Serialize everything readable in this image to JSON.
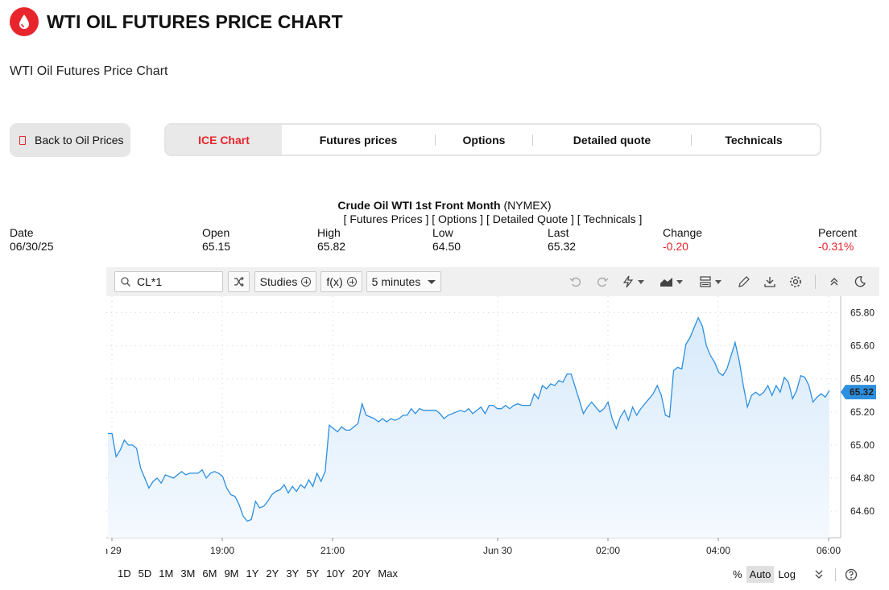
{
  "header": {
    "title": "WTI OIL FUTURES PRICE CHART",
    "logo_icon": "oil-drop-icon",
    "subtitle": "WTI Oil Futures Price Chart"
  },
  "nav": {
    "back_label": "Back to Oil Prices",
    "tabs": [
      {
        "label": "ICE Chart",
        "active": true
      },
      {
        "label": "Futures prices",
        "active": false
      },
      {
        "label": "Options",
        "active": false
      },
      {
        "label": "Detailed quote",
        "active": false
      },
      {
        "label": "Technicals",
        "active": false
      }
    ]
  },
  "instrument": {
    "name": "Crude Oil WTI 1st Front Month",
    "exchange": "(NYMEX)",
    "links": "[ Futures Prices ] [ Options ] [ Detailed Quote ] [ Technicals ]"
  },
  "quote": {
    "date_label": "Date",
    "date": "06/30/25",
    "open_label": "Open",
    "open": "65.15",
    "high_label": "High",
    "high": "65.82",
    "low_label": "Low",
    "low": "64.50",
    "last_label": "Last",
    "last": "65.32",
    "change_label": "Change",
    "change": "-0.20",
    "percent_label": "Percent",
    "percent": "-0.31%"
  },
  "toolbar": {
    "symbol": "CL*1",
    "studies_label": "Studies",
    "fx_label": "f(x)",
    "interval": "5 minutes",
    "icons": [
      "search-icon",
      "shuffle-icon",
      "undo-icon",
      "redo-icon",
      "lightning-icon",
      "area-chart-icon",
      "layout-icon",
      "pencil-icon",
      "download-icon",
      "gear-icon",
      "collapse-icon",
      "moon-icon"
    ]
  },
  "chart_data": {
    "type": "area",
    "title": "",
    "xlabel": "",
    "ylabel": "",
    "x_tick_labels": [
      "n 29",
      "19:00",
      "21:00",
      "Jun 30",
      "02:00",
      "04:00",
      "06:00"
    ],
    "y_ticks": [
      64.6,
      64.8,
      65.0,
      65.2,
      65.4,
      65.6,
      65.8
    ],
    "ylim": [
      64.44,
      65.9
    ],
    "y_axis_side": "right",
    "grid": true,
    "last_price_label": "65.32",
    "line_color": "#2d8fe0",
    "fill_color": "#d8eafb",
    "series": [
      {
        "values": [
          65.07,
          65.07,
          64.93,
          64.97,
          65.03,
          65.0,
          65.0,
          64.98,
          64.86,
          64.8,
          64.74,
          64.78,
          64.8,
          64.77,
          64.82,
          64.81,
          64.8,
          64.82,
          64.84,
          64.82,
          64.83,
          64.83,
          64.83,
          64.85,
          64.8,
          64.83,
          64.84,
          64.83,
          64.81,
          64.74,
          64.7,
          64.69,
          64.64,
          64.57,
          64.54,
          64.55,
          64.66,
          64.62,
          64.63,
          64.66,
          64.7,
          64.72,
          64.73,
          64.76,
          64.71,
          64.75,
          64.72,
          64.76,
          64.74,
          64.79,
          64.75,
          64.83,
          64.78,
          64.84,
          65.12,
          65.1,
          65.08,
          65.11,
          65.09,
          65.09,
          65.11,
          65.13,
          65.25,
          65.18,
          65.17,
          65.16,
          65.14,
          65.16,
          65.14,
          65.16,
          65.15,
          65.16,
          65.18,
          65.18,
          65.22,
          65.19,
          65.22,
          65.21,
          65.21,
          65.21,
          65.21,
          65.19,
          65.16,
          65.18,
          65.19,
          65.2,
          65.21,
          65.2,
          65.22,
          65.19,
          65.21,
          65.23,
          65.19,
          65.24,
          65.24,
          65.22,
          65.22,
          65.24,
          65.22,
          65.24,
          65.25,
          65.24,
          65.24,
          65.24,
          65.31,
          65.28,
          65.36,
          65.34,
          65.37,
          65.36,
          65.39,
          65.38,
          65.43,
          65.43,
          65.35,
          65.27,
          65.19,
          65.23,
          65.26,
          65.23,
          65.2,
          65.22,
          65.26,
          65.16,
          65.1,
          65.17,
          65.21,
          65.15,
          65.23,
          65.18,
          65.22,
          65.25,
          65.28,
          65.31,
          65.36,
          65.3,
          65.18,
          65.17,
          65.45,
          65.47,
          65.46,
          65.61,
          65.65,
          65.71,
          65.77,
          65.72,
          65.6,
          65.54,
          65.5,
          65.44,
          65.42,
          65.46,
          65.54,
          65.62,
          65.51,
          65.36,
          65.23,
          65.3,
          65.32,
          65.3,
          65.32,
          65.36,
          65.3,
          65.36,
          65.32,
          65.41,
          65.38,
          65.28,
          65.33,
          65.42,
          65.41,
          65.36,
          65.26,
          65.29,
          65.31,
          65.29,
          65.33
        ]
      }
    ]
  },
  "bottom_bar": {
    "periods": [
      "1D",
      "5D",
      "1M",
      "3M",
      "6M",
      "9M",
      "1Y",
      "2Y",
      "3Y",
      "5Y",
      "10Y",
      "20Y",
      "Max"
    ],
    "scale_options": [
      "%",
      "Auto",
      "Log"
    ],
    "active_scale": "Auto",
    "icons": [
      "chevrons-down-icon",
      "help-icon"
    ]
  }
}
